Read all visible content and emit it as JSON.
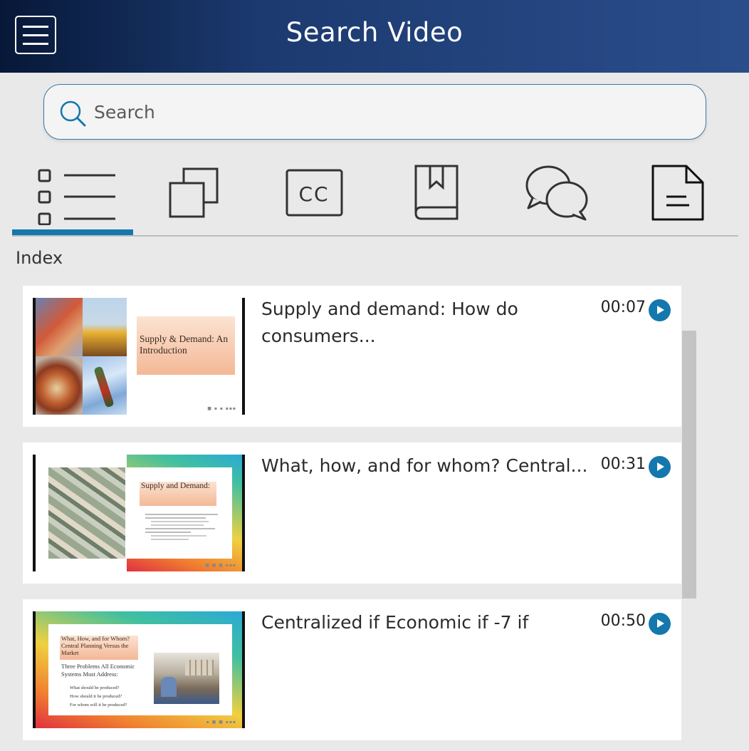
{
  "header": {
    "title": "Search Video"
  },
  "search": {
    "placeholder": "Search",
    "value": ""
  },
  "tabs": [
    {
      "icon": "index-list-icon",
      "active": true
    },
    {
      "icon": "slides-icon",
      "active": false
    },
    {
      "icon": "closed-captions-icon",
      "active": false
    },
    {
      "icon": "bookmark-icon",
      "active": false
    },
    {
      "icon": "comments-icon",
      "active": false
    },
    {
      "icon": "notes-icon",
      "active": false
    }
  ],
  "tab_labels": {
    "cc": "CC"
  },
  "section": {
    "label": "Index"
  },
  "results": [
    {
      "title": "Supply and demand: How do consumers...",
      "time": "00:07",
      "slide_title": "Supply & Demand: An Introduction"
    },
    {
      "title": "What, how, and for whom? Central...",
      "time": "00:31",
      "slide_title": "Supply and Demand:"
    },
    {
      "title": "Centralized if Economic if -7 if",
      "time": "00:50",
      "slide_title": "What, How, and for Whom? Central Planning Versus the Market",
      "slide_bullets": [
        "Three Problems All Economic Systems Must Address:",
        "What should be produced?",
        "How should it be produced?",
        "For whom will it be produced?"
      ]
    }
  ],
  "colors": {
    "accent": "#1477ae",
    "header_dark": "#071838",
    "header_light": "#2a4d8b"
  }
}
